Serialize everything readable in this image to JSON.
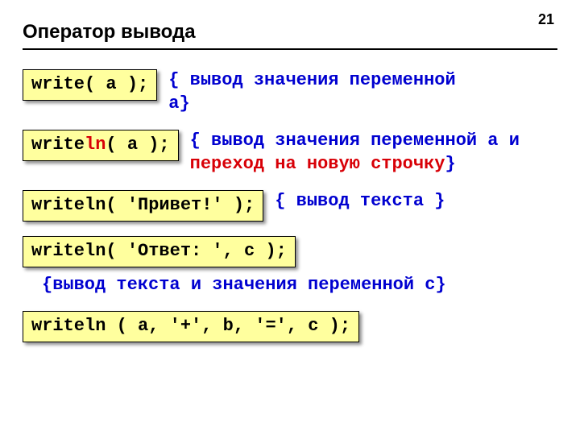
{
  "page_number": "21",
  "title": "Оператор вывода",
  "items": [
    {
      "code_pre": "write",
      "code_mid": "",
      "code_post": "( a );",
      "comment_open": "{ ",
      "comment_blue": "вывод значения переменной a",
      "comment_red": "",
      "comment_close": "}"
    },
    {
      "code_pre": "write",
      "code_mid": "ln",
      "code_post": "( a );",
      "comment_open": "{ ",
      "comment_blue": "вывод значения переменной a и ",
      "comment_red": "переход на новую строчку",
      "comment_close": "}"
    },
    {
      "code_pre": "writeln( 'Привет!' );",
      "code_mid": "",
      "code_post": "",
      "comment_open": "{ ",
      "comment_blue": "вывод текста",
      "comment_red": "",
      "comment_close": " }"
    },
    {
      "code_pre": "writeln( 'Ответ: ', c );",
      "code_mid": "",
      "code_post": "",
      "below_open": "{",
      "below_blue": "вывод текста и значения переменной c",
      "below_close": "}"
    },
    {
      "code_pre": "writeln ( a, '+', b, '=', c );",
      "code_mid": "",
      "code_post": ""
    }
  ]
}
